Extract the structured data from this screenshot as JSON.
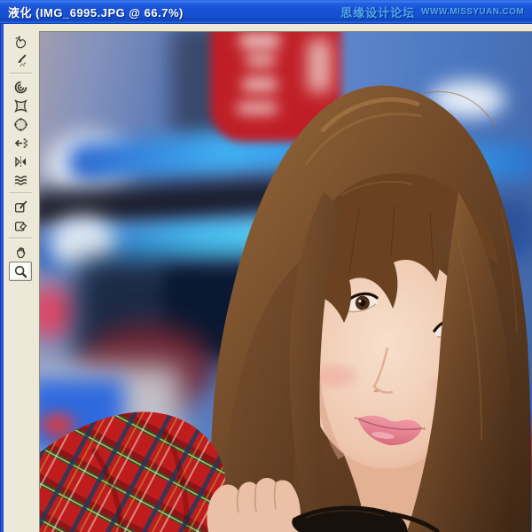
{
  "window": {
    "title": "液化 (IMG_6995.JPG @ 66.7%)",
    "dialog_name": "液化",
    "watermark": {
      "site_name": "思缘设计论坛",
      "site_url": "WWW.MISSYUAN.COM"
    }
  },
  "document": {
    "filename": "IMG_6995.JPG",
    "zoom_level": "66.7%"
  },
  "toolbar": {
    "tools": [
      {
        "icon": "forward-warp-icon",
        "selected": false
      },
      {
        "icon": "reconstruct-icon",
        "selected": false
      },
      {
        "icon": "twirl-clockwise-icon",
        "selected": false
      },
      {
        "icon": "pucker-icon",
        "selected": false
      },
      {
        "icon": "bloat-icon",
        "selected": false
      },
      {
        "icon": "push-left-icon",
        "selected": false
      },
      {
        "icon": "mirror-icon",
        "selected": false
      },
      {
        "icon": "turbulence-icon",
        "selected": false
      },
      {
        "icon": "freeze-mask-icon",
        "selected": false
      },
      {
        "icon": "thaw-mask-icon",
        "selected": false
      },
      {
        "icon": "hand-icon",
        "selected": false
      },
      {
        "icon": "zoom-icon",
        "selected": true
      }
    ]
  },
  "colors": {
    "titlebar_blue": "#1850d2",
    "window_chrome": "#ece9d8",
    "watermark_blue": "#4fa8ee",
    "neon_blue": "#47c4f5",
    "sign_red": "#c01e26",
    "hair_brown": "#6b4526",
    "skin_tone": "#f0d2be",
    "shirt_plaid_red": "#bf1d1d"
  }
}
